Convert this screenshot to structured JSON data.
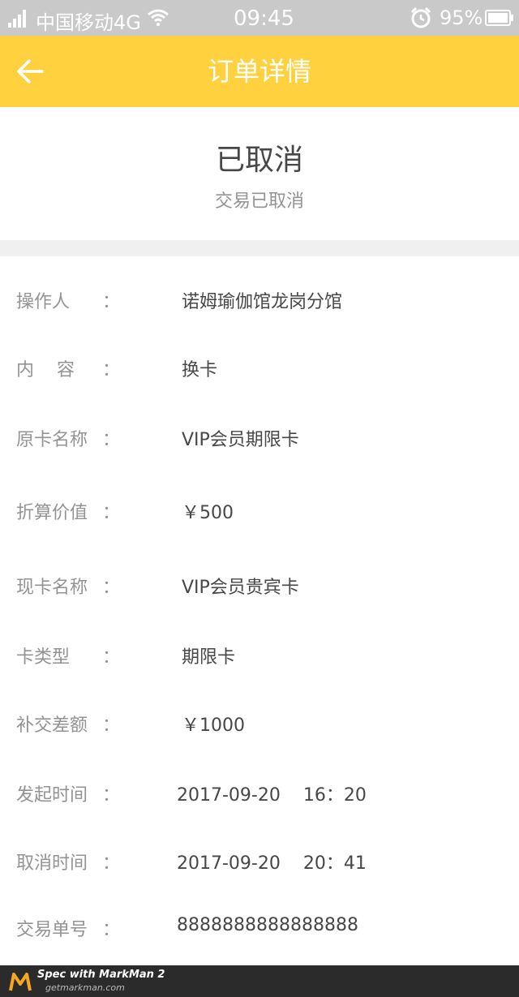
{
  "status_bar": {
    "carrier": "中国移动4G",
    "time": "09:45",
    "battery": "95%"
  },
  "nav": {
    "title": "订单详情"
  },
  "order_status": {
    "main": "已取消",
    "sub": "交易已取消"
  },
  "details": [
    {
      "label": "操作人",
      "value": "诺姆瑜伽馆龙岗分馆"
    },
    {
      "label": "内容",
      "value": "换卡"
    },
    {
      "label": "原卡名称",
      "value": "VIP会员期限卡"
    },
    {
      "label": "折算价值",
      "value": "￥500"
    },
    {
      "label": "现卡名称",
      "value": "VIP会员贵宾卡"
    },
    {
      "label": "卡类型",
      "value": "期限卡"
    },
    {
      "label": "补交差额",
      "value": "￥1000"
    },
    {
      "label": "发起时间",
      "value": "2017-09-20    16：20"
    },
    {
      "label": "取消时间",
      "value": "2017-09-20    20：41"
    },
    {
      "label": "交易单号",
      "value": "8888888888888888"
    }
  ],
  "colon": "：",
  "footer": {
    "line1": "Spec with MarkMan 2",
    "line2": "getmarkman.com"
  },
  "colors": {
    "nav_bg": "#ffd13f",
    "label_text": "#939393",
    "value_text": "#474747",
    "divider": "#f0f0f0"
  }
}
